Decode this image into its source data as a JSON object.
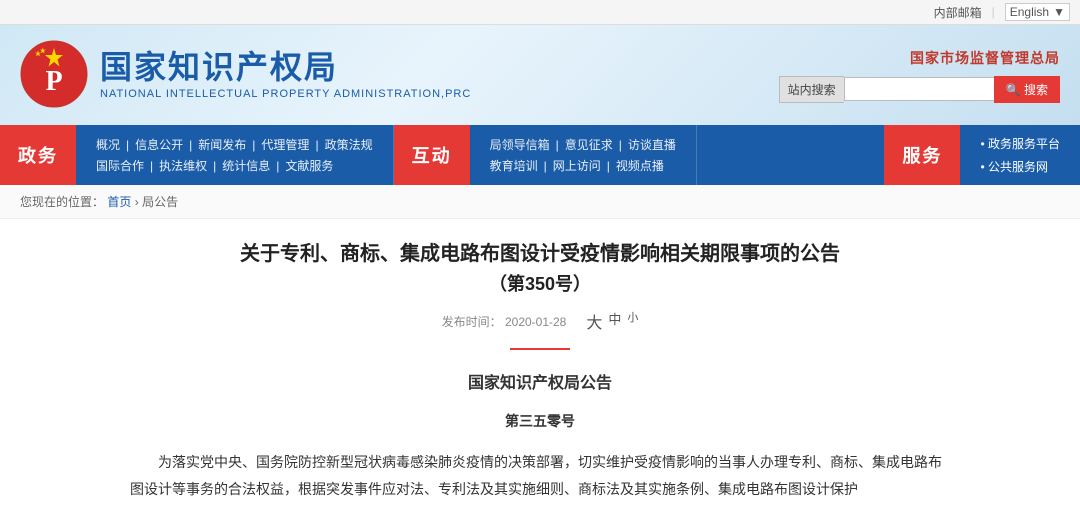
{
  "topbar": {
    "internal_mail": "内部邮箱",
    "language": "English",
    "divider": "|"
  },
  "header": {
    "logo_cn": "国家知识产权局",
    "logo_en": "NATIONAL INTELLECTUAL PROPERTY ADMINISTRATION,PRC",
    "gov_agency": "国家市场监督管理总局",
    "search_placeholder": "站内搜索",
    "search_button": "搜索"
  },
  "nav": {
    "politics_label": "政务",
    "politics_row1": [
      "概况",
      "信息公开",
      "新闻发布",
      "代理管理",
      "政策法规"
    ],
    "politics_row2": [
      "国际合作",
      "执法维权",
      "统计信息",
      "文献服务"
    ],
    "interactive_label": "互动",
    "interactive_row1": [
      "局领导信箱",
      "意见征求",
      "访谈直播"
    ],
    "interactive_row2": [
      "教育培训",
      "网上访问",
      "视频点播"
    ],
    "service_label": "服务",
    "service_links": [
      "政务服务平台",
      "公共服务网"
    ]
  },
  "breadcrumb": {
    "current_prefix": "您现在的位置：",
    "home": "首页",
    "sep": "›",
    "current": "局公告"
  },
  "article": {
    "title": "关于专利、商标、集成电路布图设计受疫情影响相关期限事项的公告",
    "subtitle": "（第350号）",
    "publish_date_label": "发布时间：",
    "publish_date": "2020-01-28",
    "font_large": "大",
    "font_medium": "中",
    "font_small": "小",
    "body_title": "国家知识产权局公告",
    "body_subtitle": "第三五零号",
    "para1": "为落实党中央、国务院防控新型冠状病毒感染肺炎疫情的决策部署，切实维护受疫情影响的当事人办理专利、商标、集成电路布图设计等事务的合法权益，根据突发事件应对法、专利法及其实施细则、商标法及其实施条例、集成电路布图设计保护"
  }
}
